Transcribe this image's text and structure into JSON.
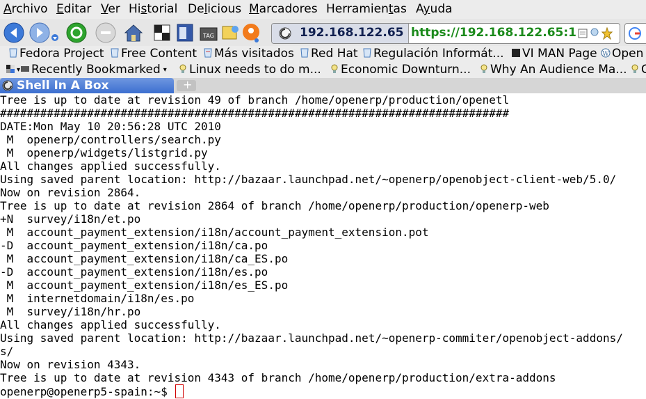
{
  "menu": [
    "Archivo",
    "Editar",
    "Ver",
    "Historial",
    "Delicious",
    "Marcadores",
    "Herramientas",
    "Ayuda"
  ],
  "menu_underline": [
    "A",
    "E",
    "V",
    "s",
    "l",
    "M",
    "t",
    "y"
  ],
  "navbar": {
    "site_label": "192.168.122.65",
    "url": "https://192.168.122.65:1"
  },
  "bookmarks_row1": [
    "Fedora Project",
    "Free Content",
    "Más visitados",
    "Red Hat",
    "Regulación Informát...",
    "VI MAN Page",
    "Open"
  ],
  "bookmarks_row2": [
    "Recently Bookmarked",
    "Linux needs to do m...",
    "Economic Downturn...",
    "Why An Audience Ma...",
    "C"
  ],
  "tab": {
    "label": "Shell In A Box"
  },
  "terminal": {
    "lines": [
      "Tree is up to date at revision 49 of branch /home/openerp/production/openetl",
      "############################################################################",
      "DATE:Mon May 10 20:56:28 UTC 2010",
      " M  openerp/controllers/search.py",
      " M  openerp/widgets/listgrid.py",
      "All changes applied successfully.",
      "Using saved parent location: http://bazaar.launchpad.net/~openerp/openobject-client-web/5.0/",
      "Now on revision 2864.",
      "Tree is up to date at revision 2864 of branch /home/openerp/production/openerp-web",
      "+N  survey/i18n/et.po",
      " M  account_payment_extension/i18n/account_payment_extension.pot",
      "-D  account_payment_extension/i18n/ca.po",
      " M  account_payment_extension/i18n/ca_ES.po",
      "-D  account_payment_extension/i18n/es.po",
      " M  account_payment_extension/i18n/es_ES.po",
      " M  internetdomain/i18n/es.po",
      " M  survey/i18n/hr.po",
      "All changes applied successfully.",
      "Using saved parent location: http://bazaar.launchpad.net/~openerp-commiter/openobject-addons/",
      "s/",
      "Now on revision 4343.",
      "Tree is up to date at revision 4343 of branch /home/openerp/production/extra-addons"
    ],
    "prompt": "openerp@openerp5-spain:~$ "
  },
  "colors": {
    "tab_active": "#3c6fd0",
    "url_https": "#1b8a1b",
    "cursor": "#d00000"
  }
}
